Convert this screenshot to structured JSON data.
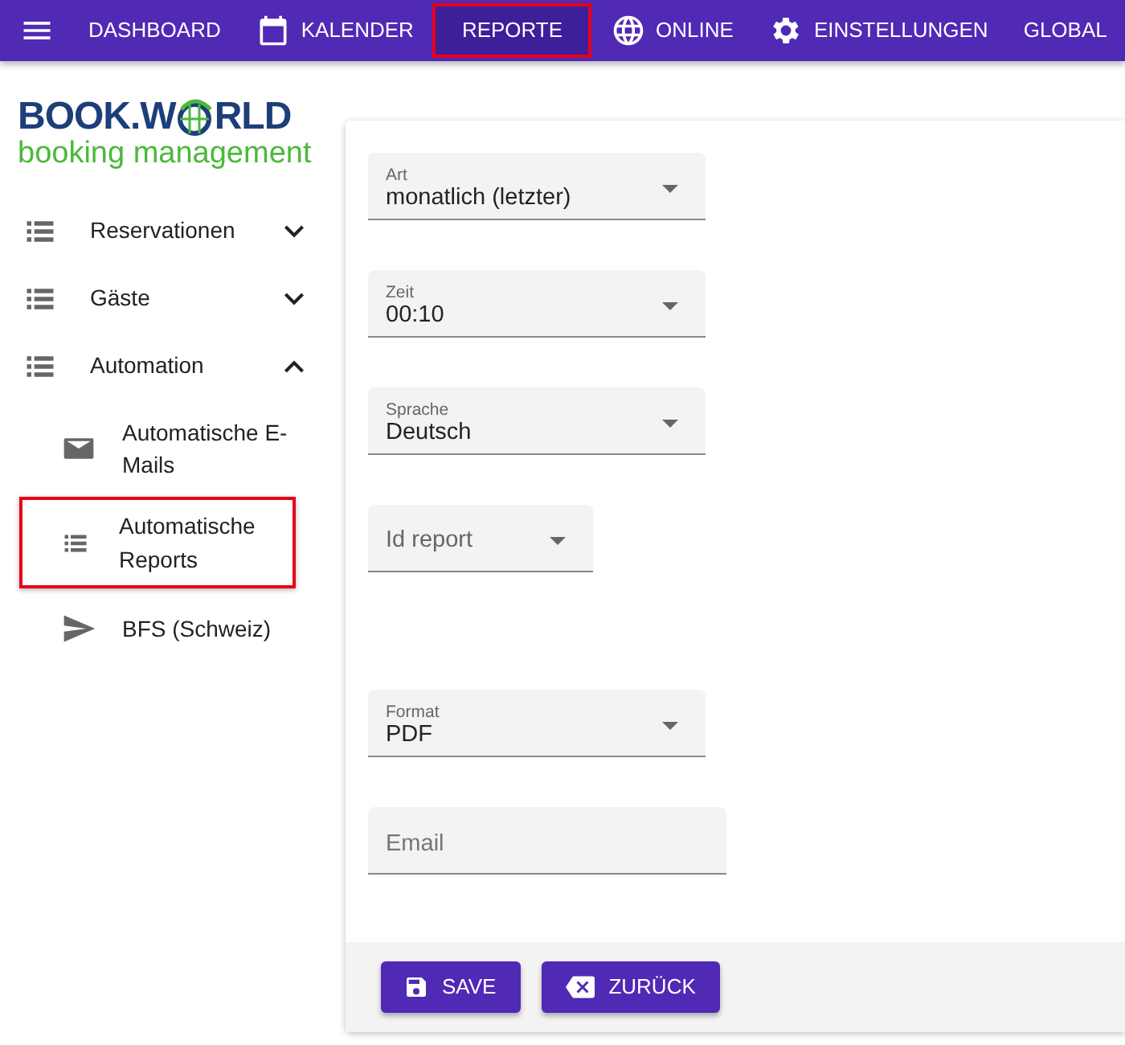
{
  "navbar": {
    "items": [
      {
        "label": "DASHBOARD",
        "selected": false
      },
      {
        "label": "KALENDER",
        "selected": false
      },
      {
        "label": "REPORTE",
        "selected": true
      },
      {
        "label": "ONLINE",
        "selected": false
      },
      {
        "label": "EINSTELLUNGEN",
        "selected": false
      },
      {
        "label": "GLOBAL",
        "selected": false
      }
    ]
  },
  "logo": {
    "text_before": "BOOK.W",
    "text_after": "RLD",
    "tagline": "booking management"
  },
  "sidebar": {
    "items": [
      {
        "label": "Reservationen",
        "expanded": false
      },
      {
        "label": "Gäste",
        "expanded": false
      },
      {
        "label": "Automation",
        "expanded": true,
        "children": [
          {
            "label": "Automatische E-Mails",
            "selected": false
          },
          {
            "label": "Automatische Reports",
            "selected": true
          },
          {
            "label": "BFS (Schweiz)",
            "selected": false
          }
        ]
      }
    ]
  },
  "form": {
    "fields": [
      {
        "kind": "select",
        "label": "Art",
        "value": "monatlich (letzter)"
      },
      {
        "kind": "select",
        "label": "Zeit",
        "value": "00:10"
      },
      {
        "kind": "select",
        "label": "Sprache",
        "value": "Deutsch"
      },
      {
        "kind": "select",
        "placeholder": "Id report"
      },
      {
        "kind": "select",
        "label": "Format",
        "value": "PDF"
      },
      {
        "kind": "text",
        "placeholder": "Email"
      }
    ],
    "buttons": [
      {
        "label": "SAVE",
        "kind": "save"
      },
      {
        "label": "ZURÜCK",
        "kind": "back"
      }
    ]
  }
}
